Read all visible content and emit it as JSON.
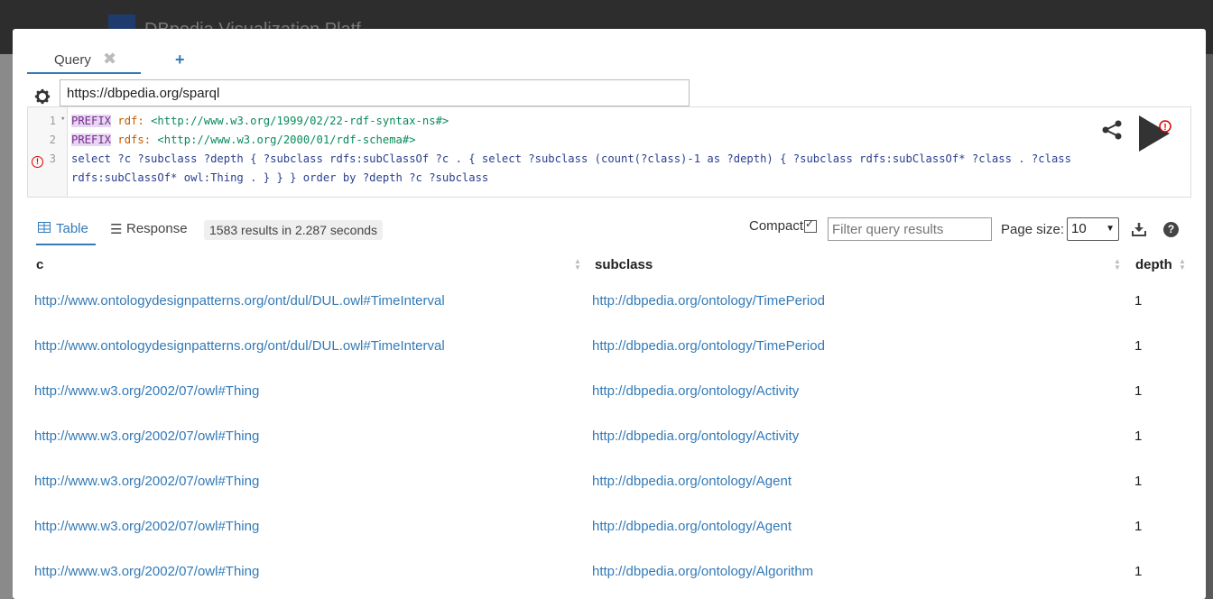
{
  "background": {
    "title": "DBpedia Visualization Platf"
  },
  "tabs": {
    "query_label": "Query",
    "add_label": "+"
  },
  "endpoint": {
    "value": "https://dbpedia.org/sparql"
  },
  "editor": {
    "line_numbers": [
      "1",
      "2",
      "3"
    ],
    "line1": {
      "kw": "PREFIX",
      "prefix": " rdf: ",
      "iri": "<http://www.w3.org/1999/02/22-rdf-syntax-ns#>"
    },
    "line2": {
      "kw": "PREFIX",
      "prefix": " rdfs: ",
      "iri": "<http://www.w3.org/2000/01/rdf-schema#>"
    },
    "line3a": "select ?c ?subclass ?depth { ?subclass rdfs:subClassOf ?c . { select ?subclass (count(?class)-1 as ?depth) { ?subclass rdfs:subClassOf* ?class . ?class",
    "line3b": "rdfs:subClassOf* owl:Thing . } } } order by ?depth ?c ?subclass",
    "error_marker": "!"
  },
  "results": {
    "tab_table": "Table",
    "tab_response": "Response",
    "summary": "1583 results in 2.287 seconds",
    "compact_label": "Compact",
    "filter_placeholder": "Filter query results",
    "page_size_label": "Page size:",
    "page_size_value": "10",
    "help_label": "?",
    "columns": [
      "c",
      "subclass",
      "depth"
    ],
    "rows": [
      {
        "c": "http://www.ontologydesignpatterns.org/ont/dul/DUL.owl#TimeInterval",
        "subclass": "http://dbpedia.org/ontology/TimePeriod",
        "depth": "1"
      },
      {
        "c": "http://www.ontologydesignpatterns.org/ont/dul/DUL.owl#TimeInterval",
        "subclass": "http://dbpedia.org/ontology/TimePeriod",
        "depth": "1"
      },
      {
        "c": "http://www.w3.org/2002/07/owl#Thing",
        "subclass": "http://dbpedia.org/ontology/Activity",
        "depth": "1"
      },
      {
        "c": "http://www.w3.org/2002/07/owl#Thing",
        "subclass": "http://dbpedia.org/ontology/Activity",
        "depth": "1"
      },
      {
        "c": "http://www.w3.org/2002/07/owl#Thing",
        "subclass": "http://dbpedia.org/ontology/Agent",
        "depth": "1"
      },
      {
        "c": "http://www.w3.org/2002/07/owl#Thing",
        "subclass": "http://dbpedia.org/ontology/Agent",
        "depth": "1"
      },
      {
        "c": "http://www.w3.org/2002/07/owl#Thing",
        "subclass": "http://dbpedia.org/ontology/Algorithm",
        "depth": "1"
      }
    ]
  },
  "colors": {
    "accent": "#337ab7",
    "error": "#dd0000"
  }
}
